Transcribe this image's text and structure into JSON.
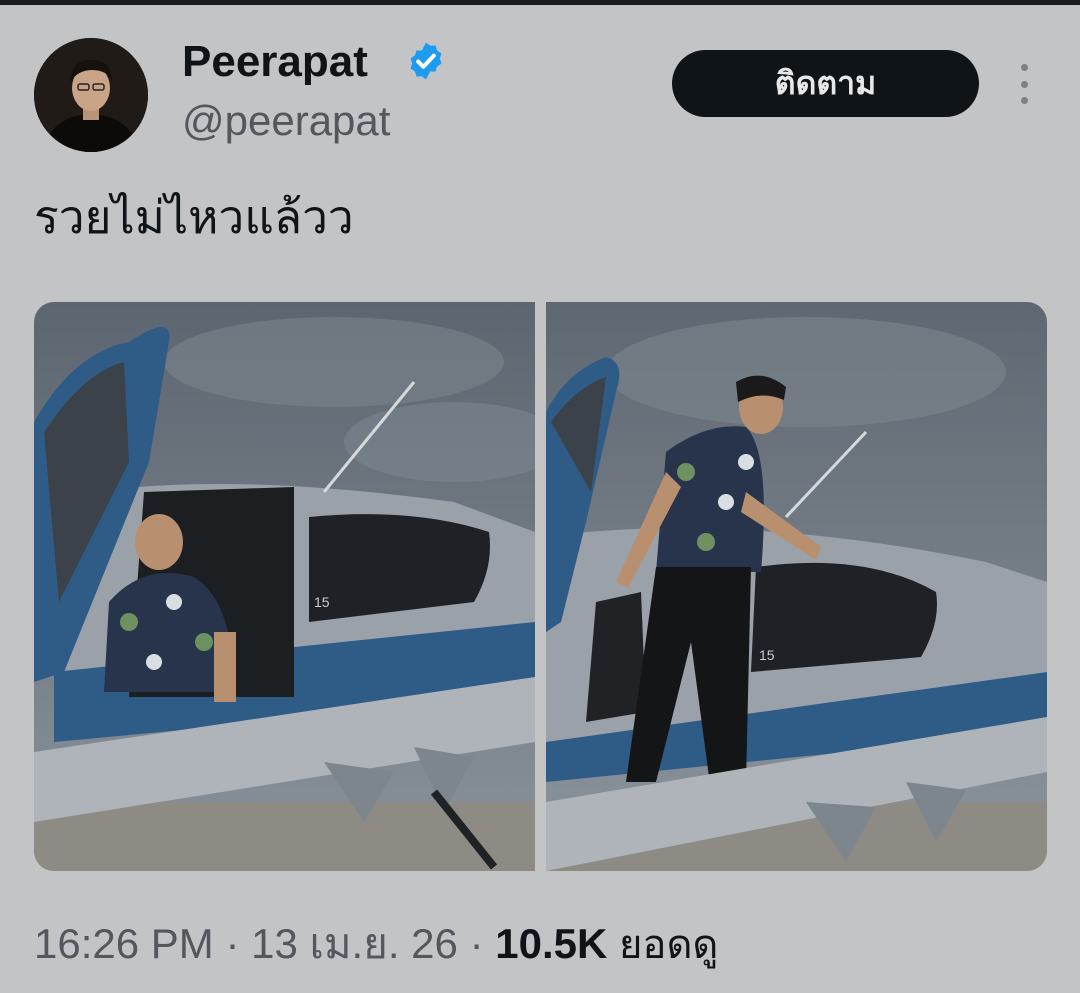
{
  "tweet": {
    "author": {
      "display_name": "Peerapat",
      "handle": "@peerapat",
      "verified": true
    },
    "follow_label": "ติดตาม",
    "text": "รวยไม่ไหวแล้วว",
    "media": [
      {
        "description": "aircraft-photo",
        "plate": "15"
      },
      {
        "description": "aircraft-photo",
        "plate": "15"
      }
    ],
    "time": "16:26 PM",
    "separator": "·",
    "date": "13 เม.ย. 26",
    "views_count": "10.5K",
    "views_label": "ยอดดู"
  },
  "colors": {
    "background": "#c3c4c6",
    "follow_button_bg": "#0f1419",
    "verified_badge": "#1d9bf0",
    "secondary_text": "#53585e"
  }
}
